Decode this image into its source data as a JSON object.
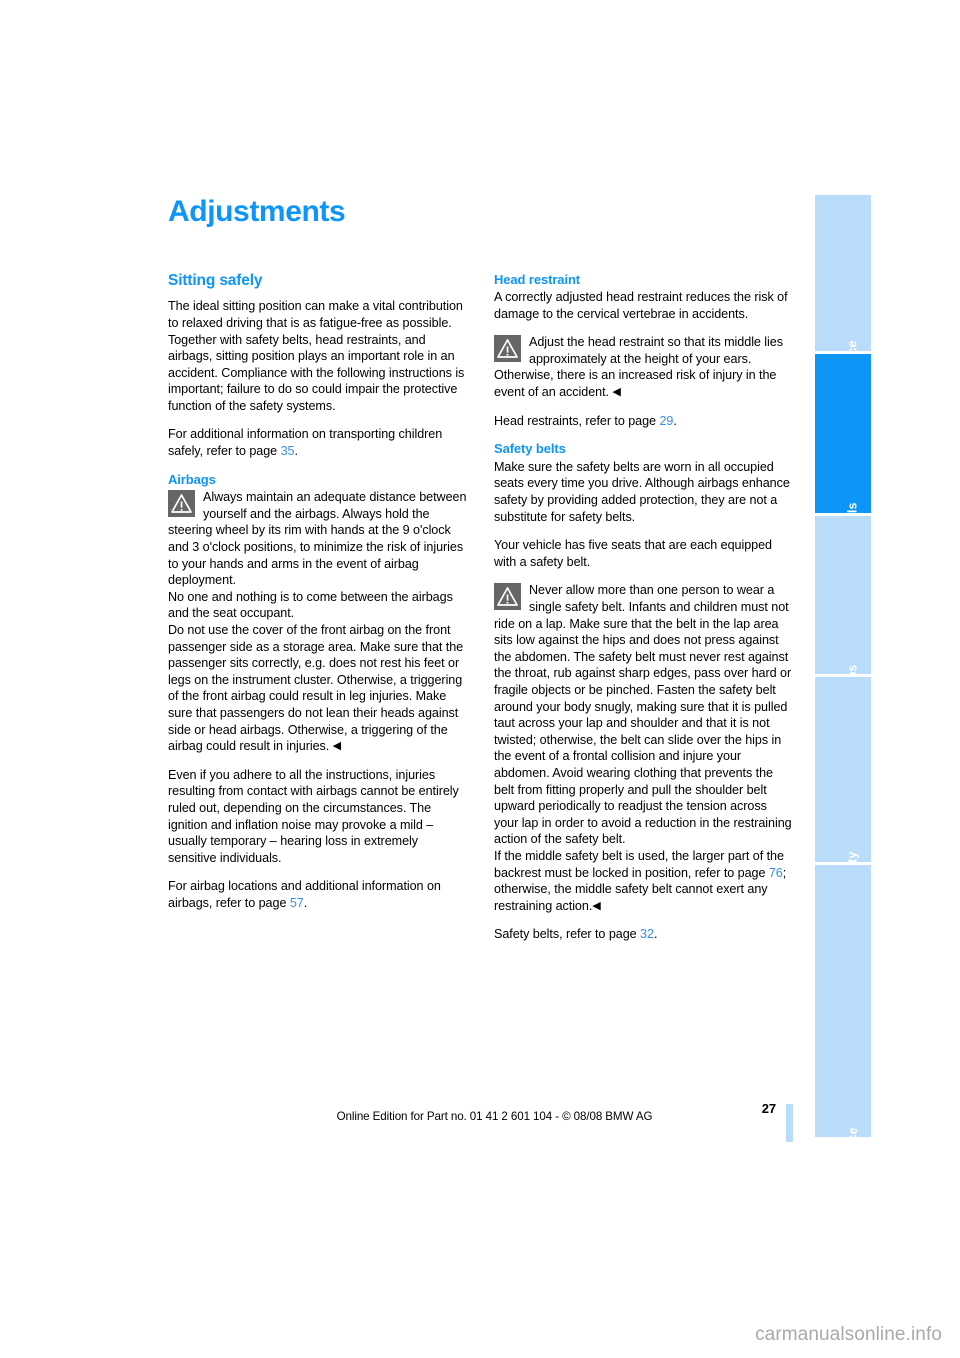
{
  "document": {
    "title": "Adjustments",
    "page_number": "27",
    "footer_note": "Online Edition for Part no. 01 41 2 601 104 - © 08/08 BMW AG",
    "watermark": "carmanualsonline.info"
  },
  "colors": {
    "accent_blue": "#0d95f7",
    "tab_inactive": "#b9dcfb",
    "page_link": "#3b8fe8",
    "warn_icon_bg": "#666666"
  },
  "side_nav": {
    "tabs": [
      {
        "label": "At a glance",
        "active": false
      },
      {
        "label": "Controls",
        "active": true
      },
      {
        "label": "Driving tips",
        "active": false
      },
      {
        "label": "Mobility",
        "active": false
      },
      {
        "label": "Reference",
        "active": false
      }
    ]
  },
  "left_column": {
    "section_heading": "Sitting safely",
    "intro_paragraph": "The ideal sitting position can make a vital contribution to relaxed driving that is as fatigue-free as possible. Together with safety belts, head restraints, and airbags, sitting position plays an important role in an accident. Compliance with the following instructions is important; failure to do so could impair the protective function of the safety systems.",
    "children_ref_before": "For additional information on transporting children safely, refer to page ",
    "children_ref_page": "35",
    "children_ref_after": ".",
    "airbags_heading": "Airbags",
    "airbags_warning": "Always maintain an adequate distance between yourself and the airbags. Always hold the steering wheel by its rim with hands at the 9 o'clock and 3 o'clock positions, to minimize the risk of injuries to your hands and arms in the event of airbag deployment.",
    "airbags_warning_2": "No one and nothing is to come between the airbags and the seat occupant.",
    "airbags_warning_3": "Do not use the cover of the front airbag on the front passenger side as a storage area. Make sure that the passenger sits correctly, e.g. does not rest his feet or legs on the instrument cluster. Otherwise, a triggering of the front airbag could result in leg injuries. Make sure that passengers do not lean their heads against side or head airbags. Otherwise, a triggering of the airbag could result in injuries.",
    "airbags_note": "Even if you adhere to all the instructions, injuries resulting from contact with airbags cannot be entirely ruled out, depending on the circumstances. The ignition and inflation noise may provoke a mild – usually temporary – hearing loss in extremely sensitive individuals.",
    "airbags_ref_before": "For airbag locations and additional information on airbags, refer to page ",
    "airbags_ref_page": "57",
    "airbags_ref_after": "."
  },
  "right_column": {
    "head_restraint_heading": "Head restraint",
    "head_restraint_intro": "A correctly adjusted head restraint reduces the risk of damage to the cervical vertebrae in accidents.",
    "head_restraint_warning": "Adjust the head restraint so that its middle lies approximately at the height of your ears. Otherwise, there is an increased risk of injury in the event of an accident.",
    "head_restraint_ref_before": "Head restraints, refer to page ",
    "head_restraint_ref_page": "29",
    "head_restraint_ref_after": ".",
    "safety_belts_heading": "Safety belts",
    "safety_belts_intro": "Make sure the safety belts are worn in all occupied seats every time you drive. Although airbags enhance safety by providing added protection, they are not a substitute for safety belts.",
    "safety_belts_seats": "Your vehicle has five seats that are each equipped with a safety belt.",
    "safety_belts_warning": "Never allow more than one person to wear a single safety belt. Infants and children must not ride on a lap. Make sure that the belt in the lap area sits low against the hips and does not press against the abdomen. The safety belt must never rest against the throat, rub against sharp edges, pass over hard or fragile objects or be pinched. Fasten the safety belt around your body snugly, making sure that it is pulled taut across your lap and shoulder and that it is not twisted; otherwise, the belt can slide over the hips in the event of a frontal collision and injure your abdomen. Avoid wearing clothing that prevents the belt from fitting properly and pull the shoulder belt upward periodically to readjust the tension across your lap in order to avoid a reduction in the restraining action of the safety belt.",
    "safety_belts_middle_before": "If the middle safety belt is used, the larger part of the backrest must be locked in position, refer to page ",
    "safety_belts_middle_page": "76",
    "safety_belts_middle_after": "; otherwise, the middle safety belt cannot exert any restraining action.",
    "safety_belts_ref_before": "Safety belts, refer to page ",
    "safety_belts_ref_page": "32",
    "safety_belts_ref_after": "."
  },
  "symbols": {
    "end_of_warning": "◀"
  }
}
